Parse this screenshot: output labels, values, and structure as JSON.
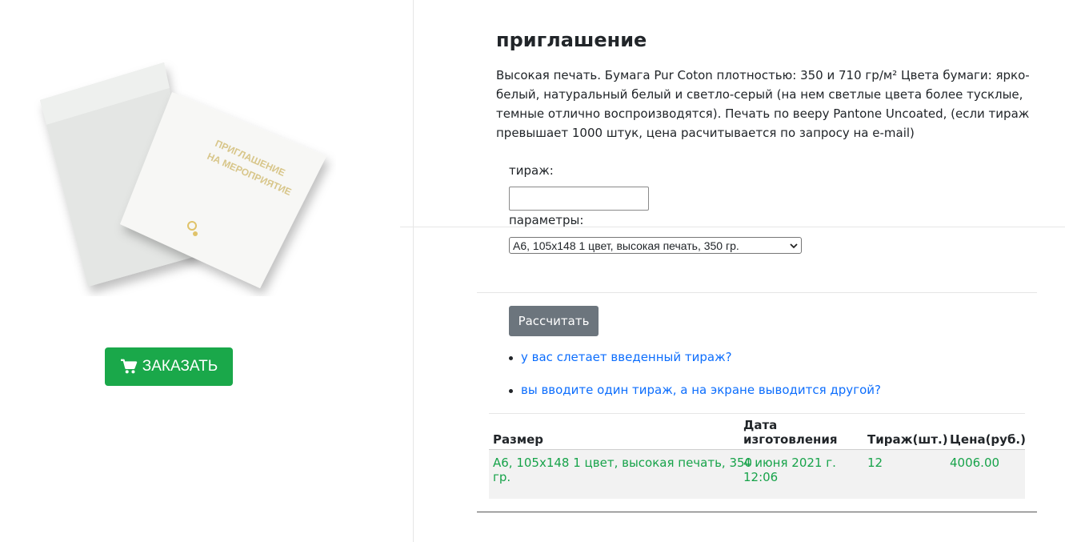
{
  "product": {
    "title": "приглашение",
    "description": "Высокая печать. Бумага Pur Coton плотностью: 350 и 710 гр/м² Цвета бумаги: ярко-белый, натуральный белый и светло-серый (на нем светлые цвета более тусклые, темные отлично воспроизводятся). Печать по вееру Pantone Uncoated, (если тираж превышает 1000 штук, цена расчитывается по запросу на e-mail)",
    "image_text_line1": "ПРИГЛАШЕНИЕ",
    "image_text_line2": "НА МЕРОПРИЯТИЕ"
  },
  "order_button": {
    "label": "ЗАКАЗАТЬ"
  },
  "form": {
    "qty_label": "тираж:",
    "qty_value": "",
    "params_label": "параметры:",
    "params_selected": "А6, 105х148 1 цвет, высокая печать, 350 гр.",
    "calc_label": "Рассчитать"
  },
  "help_links": [
    "у вас слетает введенный тираж?",
    "вы вводите один тираж, а на экране выводится другой?"
  ],
  "table": {
    "headers": {
      "size": "Размер",
      "date_line1": "Дата",
      "date_line2": "изготовления",
      "qty": "Тираж(шт.)",
      "price": "Цена(руб.)"
    },
    "rows": [
      {
        "size_line1": "А6, 105х148 1 цвет, высокая печать, 350",
        "size_line2": "гр.",
        "date_line1": "4 июня 2021 г.",
        "date_line2": "12:06",
        "qty": "12",
        "price": "4006.00"
      }
    ]
  },
  "colors": {
    "order_button": "#1aa84a",
    "calc_button": "#6c757d",
    "link": "#0d6efd",
    "table_text": "#17a34a"
  }
}
